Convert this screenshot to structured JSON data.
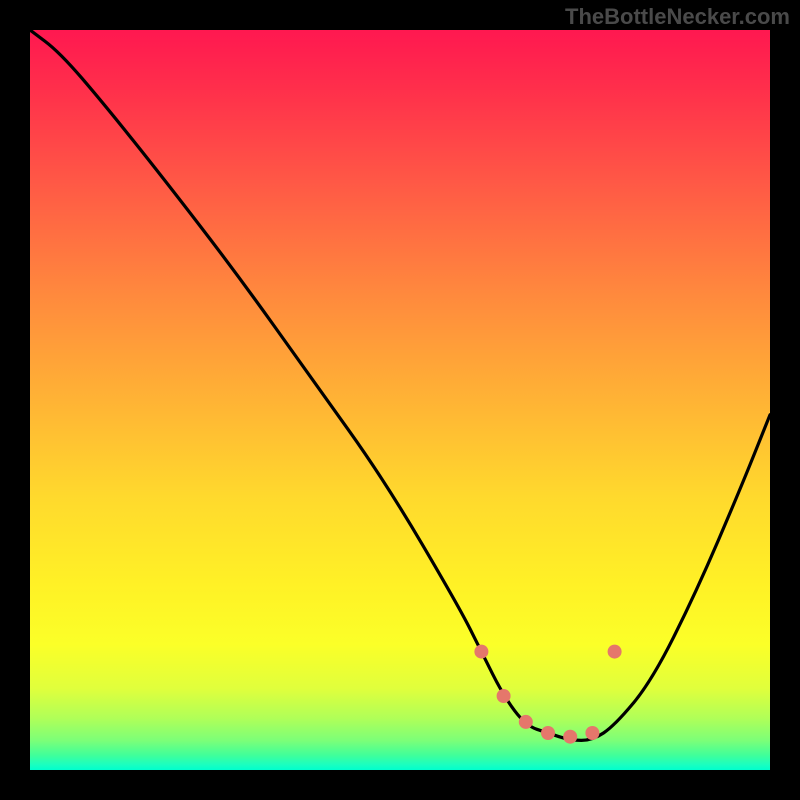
{
  "watermark": "TheBottleNecker.com",
  "chart_data": {
    "type": "line",
    "title": "",
    "xlabel": "",
    "ylabel": "",
    "xlim": [
      0,
      100
    ],
    "ylim": [
      0,
      100
    ],
    "note": "Bottleneck V-curve. X axis is relative component match; Y axis is bottleneck percentage (100 top, 0 bottom). Values estimated from pixel positions; chart has no tick labels.",
    "gradient_stops": [
      {
        "pct": 0,
        "color": "#ff1850"
      },
      {
        "pct": 8,
        "color": "#ff2f4b"
      },
      {
        "pct": 22,
        "color": "#ff5d45"
      },
      {
        "pct": 36,
        "color": "#ff8a3d"
      },
      {
        "pct": 50,
        "color": "#ffb335"
      },
      {
        "pct": 63,
        "color": "#ffd92d"
      },
      {
        "pct": 75,
        "color": "#fff126"
      },
      {
        "pct": 83,
        "color": "#fbff28"
      },
      {
        "pct": 89,
        "color": "#e0ff3c"
      },
      {
        "pct": 93,
        "color": "#b0ff58"
      },
      {
        "pct": 96,
        "color": "#7cff78"
      },
      {
        "pct": 98,
        "color": "#40ff9a"
      },
      {
        "pct": 99.3,
        "color": "#1affc0"
      },
      {
        "pct": 100,
        "color": "#00ffce"
      }
    ],
    "series": [
      {
        "name": "bottleneck-curve",
        "x": [
          0,
          4,
          10,
          18,
          28,
          38,
          48,
          58,
          61,
          64,
          67,
          70,
          73,
          76,
          79,
          84,
          90,
          96,
          100
        ],
        "y": [
          100,
          97,
          90,
          80,
          67,
          53,
          39,
          22,
          16,
          10,
          6,
          5,
          4,
          4,
          6,
          12,
          24,
          38,
          48
        ]
      }
    ],
    "markers": [
      {
        "name": "recommended-left",
        "x": 61,
        "y": 16,
        "color": "#e5776b"
      },
      {
        "name": "rec-2",
        "x": 64,
        "y": 10,
        "color": "#e5776b"
      },
      {
        "name": "rec-3",
        "x": 67,
        "y": 6.5,
        "color": "#e5776b"
      },
      {
        "name": "rec-4",
        "x": 70,
        "y": 5,
        "color": "#e5776b"
      },
      {
        "name": "rec-5",
        "x": 73,
        "y": 4.5,
        "color": "#e5776b"
      },
      {
        "name": "rec-6",
        "x": 76,
        "y": 5,
        "color": "#e5776b"
      },
      {
        "name": "recommended-right",
        "x": 79,
        "y": 16,
        "color": "#e5776b"
      }
    ]
  }
}
